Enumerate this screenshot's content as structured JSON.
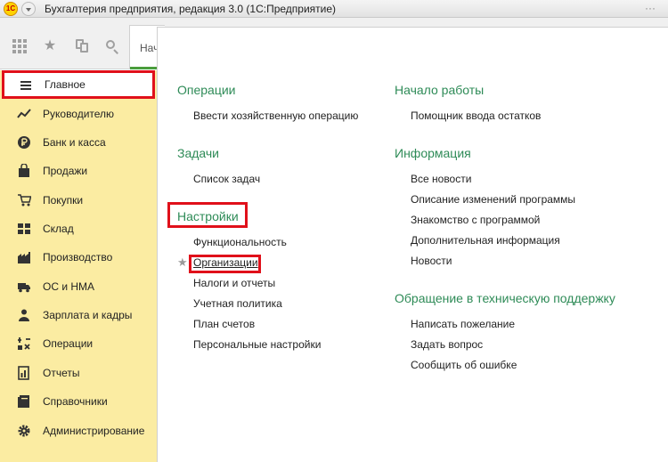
{
  "window": {
    "title": "Бухгалтерия предприятия, редакция 3.0  (1С:Предприятие)",
    "logo_text": "1С",
    "dots": "···"
  },
  "toolbar": {
    "tab_label": "Начальная страница",
    "icons": [
      "apps-grid-icon",
      "favorites-star-icon",
      "history-icon",
      "search-icon"
    ]
  },
  "sidebar": {
    "items": [
      {
        "label": "Главное",
        "icon": "menu-lines-icon",
        "selected": true
      },
      {
        "label": "Руководителю",
        "icon": "trend-chart-icon"
      },
      {
        "label": "Банк и касса",
        "icon": "ruble-coin-icon"
      },
      {
        "label": "Продажи",
        "icon": "shopping-bag-icon"
      },
      {
        "label": "Покупки",
        "icon": "shopping-cart-icon"
      },
      {
        "label": "Склад",
        "icon": "warehouse-grid-icon"
      },
      {
        "label": "Производство",
        "icon": "factory-icon"
      },
      {
        "label": "ОС и НМА",
        "icon": "truck-icon"
      },
      {
        "label": "Зарплата и кадры",
        "icon": "people-icon"
      },
      {
        "label": "Операции",
        "icon": "operations-icon"
      },
      {
        "label": "Отчеты",
        "icon": "report-icon"
      },
      {
        "label": "Справочники",
        "icon": "book-icon"
      },
      {
        "label": "Администрирование",
        "icon": "gear-icon"
      }
    ]
  },
  "main": {
    "left": [
      {
        "title": "Операции",
        "links": [
          "Ввести хозяйственную операцию"
        ]
      },
      {
        "title": "Задачи",
        "links": [
          "Список задач"
        ]
      },
      {
        "title": "Настройки",
        "links": [
          "Функциональность",
          "Организации",
          "Налоги и отчеты",
          "Учетная политика",
          "План счетов",
          "Персональные настройки"
        ]
      }
    ],
    "right": [
      {
        "title": "Начало работы",
        "links": [
          "Помощник ввода остатков"
        ]
      },
      {
        "title": "Информация",
        "links": [
          "Все новости",
          "Описание изменений программы",
          "Знакомство с программой",
          "Дополнительная информация",
          "Новости"
        ]
      },
      {
        "title": "Обращение в техническую поддержку",
        "links": [
          "Написать пожелание",
          "Задать вопрос",
          "Сообщить об ошибке"
        ]
      }
    ]
  },
  "colors": {
    "section_title": "#2e8b57",
    "sidebar_bg": "#fbeca2",
    "highlight_border": "#e0101a"
  }
}
